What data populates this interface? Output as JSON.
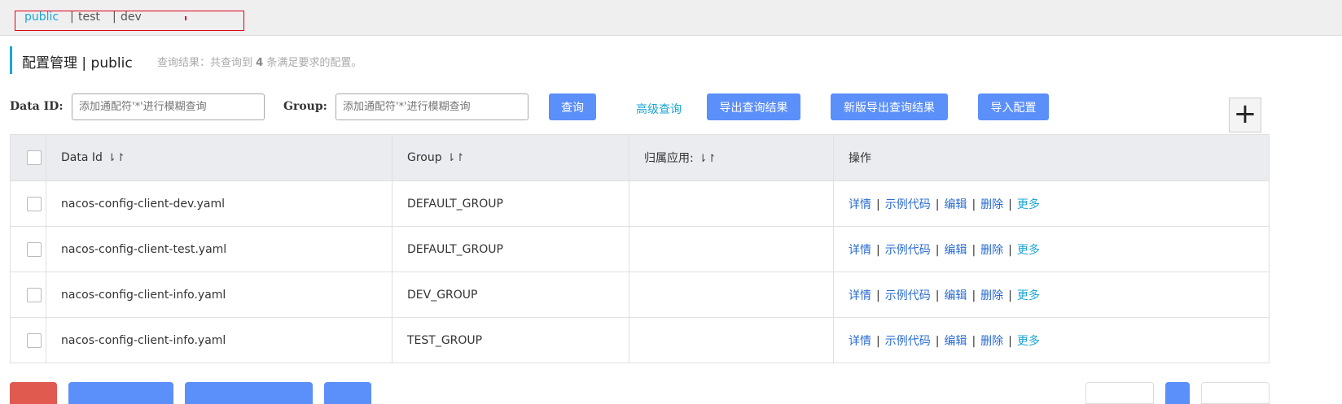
{
  "namespaces": [
    {
      "label": "public",
      "active": true
    },
    {
      "label": "test",
      "active": false
    },
    {
      "label": "dev",
      "active": false
    }
  ],
  "page_title": "配置管理 | public",
  "query_result": {
    "prefix": "查询结果：共查询到 ",
    "count": "4",
    "suffix": " 条满足要求的配置。"
  },
  "filters": {
    "data_id_label": "Data ID:",
    "data_id_placeholder": "添加通配符'*'进行模糊查询",
    "group_label": "Group:",
    "group_placeholder": "添加通配符'*'进行模糊查询"
  },
  "toolbar": {
    "search": "查询",
    "advanced": "高级查询",
    "export": "导出查询结果",
    "export_new": "新版导出查询结果",
    "import": "导入配置",
    "add": "+"
  },
  "table": {
    "headers": {
      "data_id": "Data Id",
      "group": "Group",
      "app": "归属应用:",
      "ops": "操作"
    },
    "sort_glyph": "⇂↾",
    "rows": [
      {
        "data_id": "nacos-config-client-dev.yaml",
        "group": "DEFAULT_GROUP",
        "app": ""
      },
      {
        "data_id": "nacos-config-client-test.yaml",
        "group": "DEFAULT_GROUP",
        "app": ""
      },
      {
        "data_id": "nacos-config-client-info.yaml",
        "group": "DEV_GROUP",
        "app": ""
      },
      {
        "data_id": "nacos-config-client-info.yaml",
        "group": "TEST_GROUP",
        "app": ""
      }
    ],
    "row_ops": {
      "detail": "详情",
      "sample": "示例代码",
      "edit": "编辑",
      "delete": "删除",
      "more": "更多",
      "sep": "|"
    }
  },
  "colors": {
    "accent": "#1ba6d6",
    "primary_button": "#5b8ff9",
    "highlight_box": "#e0001b",
    "bottom_red": "#e05a4f"
  }
}
